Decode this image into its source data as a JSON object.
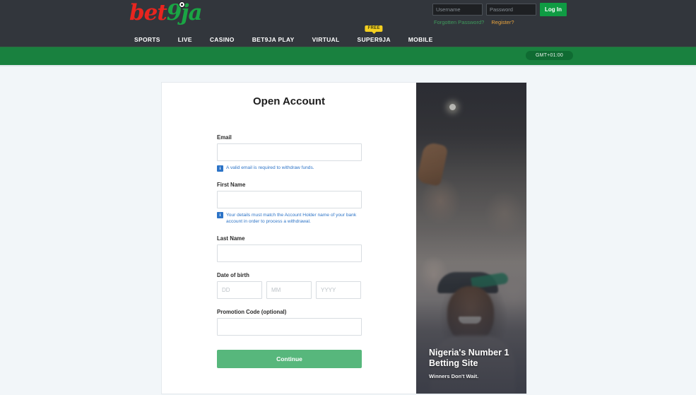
{
  "header": {
    "logo": {
      "part1": "bet",
      "part2": "9ja",
      "ball_icon": "soccer-ball-icon"
    },
    "login": {
      "username_placeholder": "Username",
      "password_placeholder": "Password",
      "username_value": "",
      "password_value": "",
      "login_label": "Log In",
      "forgotten_password": "Forgotten Password?",
      "register": "Register?"
    },
    "nav": [
      {
        "label": "SPORTS",
        "badge": null
      },
      {
        "label": "LIVE",
        "badge": null
      },
      {
        "label": "CASINO",
        "badge": null
      },
      {
        "label": "BET9JA PLAY",
        "badge": null
      },
      {
        "label": "VIRTUAL",
        "badge": null
      },
      {
        "label": "SUPER9JA",
        "badge": "FREE"
      },
      {
        "label": "MOBILE",
        "badge": null
      }
    ]
  },
  "green_bar": {
    "timezone": "GMT+01:00"
  },
  "form": {
    "title": "Open Account",
    "email": {
      "label": "Email",
      "value": "",
      "placeholder": "",
      "hint": "A valid email is required to withdraw funds.",
      "hint_icon": "info-icon"
    },
    "first_name": {
      "label": "First Name",
      "value": "",
      "placeholder": "",
      "hint": "Your details must match the Account Holder name of your bank account in order to process a withdrawal.",
      "hint_icon": "info-icon"
    },
    "last_name": {
      "label": "Last Name",
      "value": "",
      "placeholder": ""
    },
    "date_of_birth": {
      "label": "Date of birth",
      "day_placeholder": "DD",
      "month_placeholder": "MM",
      "year_placeholder": "YYYY",
      "day_value": "",
      "month_value": "",
      "year_value": ""
    },
    "promotion_code": {
      "label": "Promotion Code (optional)",
      "value": "",
      "placeholder": ""
    },
    "continue_label": "Continue"
  },
  "promo": {
    "title": "Nigeria's Number 1 Betting Site",
    "subtitle": "Winners Don't Wait.",
    "image_alt": "crowd-celebrating-photo"
  },
  "colors": {
    "brand_red": "#e8251f",
    "brand_green": "#1aa544",
    "header_bg": "#32363c",
    "green_bar": "#19813f",
    "accent_blue": "#2d74c7",
    "continue_green": "#57b77c",
    "badge_yellow": "#f5d020",
    "page_bg": "#f2f6f9"
  }
}
